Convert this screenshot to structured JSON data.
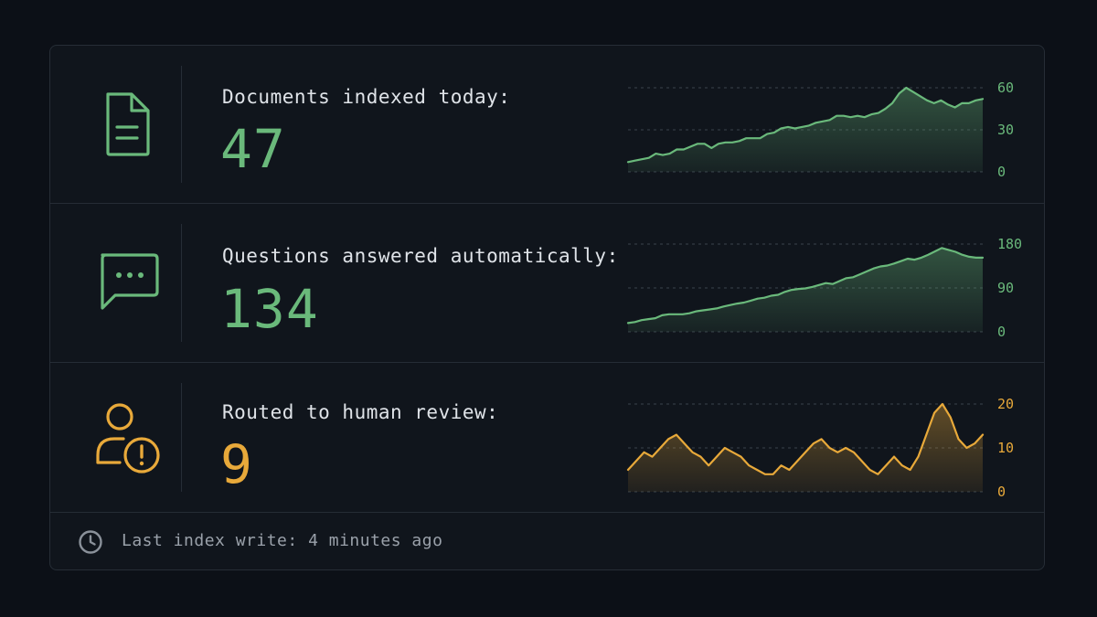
{
  "colors": {
    "green": "#6ab97b",
    "amber": "#e8a93a"
  },
  "metrics": [
    {
      "id": "docs",
      "icon": "document-icon",
      "label": "Documents indexed today:",
      "value": "47",
      "color": "#6ab97b",
      "chart_data": {
        "type": "area",
        "y_ticks": [
          0,
          30,
          60
        ],
        "ylim": [
          0,
          60
        ],
        "values": [
          7,
          8,
          9,
          10,
          13,
          12,
          13,
          16,
          16,
          18,
          20,
          20,
          17,
          20,
          21,
          21,
          22,
          24,
          24,
          24,
          27,
          28,
          31,
          32,
          31,
          32,
          33,
          35,
          36,
          37,
          40,
          40,
          39,
          40,
          39,
          41,
          42,
          45,
          49,
          56,
          60,
          57,
          54,
          51,
          49,
          51,
          48,
          46,
          49,
          49,
          51,
          52
        ]
      }
    },
    {
      "id": "questions",
      "icon": "chat-bubble-icon",
      "label": "Questions answered automatically:",
      "value": "134",
      "color": "#6ab97b",
      "chart_data": {
        "type": "area",
        "y_ticks": [
          0,
          90,
          180
        ],
        "ylim": [
          0,
          180
        ],
        "values": [
          18,
          20,
          24,
          26,
          28,
          34,
          36,
          36,
          36,
          38,
          42,
          44,
          46,
          48,
          52,
          55,
          58,
          60,
          64,
          68,
          70,
          74,
          76,
          82,
          86,
          88,
          89,
          92,
          96,
          100,
          98,
          104,
          110,
          112,
          118,
          124,
          130,
          134,
          136,
          140,
          145,
          150,
          148,
          152,
          158,
          165,
          172,
          168,
          164,
          158,
          154,
          152,
          152
        ]
      }
    },
    {
      "id": "review",
      "icon": "user-alert-icon",
      "label": "Routed to human review:",
      "value": "9",
      "color": "#e8a93a",
      "chart_data": {
        "type": "area",
        "y_ticks": [
          0,
          10,
          20
        ],
        "ylim": [
          0,
          20
        ],
        "values": [
          5,
          7,
          9,
          8,
          10,
          12,
          13,
          11,
          9,
          8,
          6,
          8,
          10,
          9,
          8,
          6,
          5,
          4,
          4,
          6,
          5,
          7,
          9,
          11,
          12,
          10,
          9,
          10,
          9,
          7,
          5,
          4,
          6,
          8,
          6,
          5,
          8,
          13,
          18,
          20,
          17,
          12,
          10,
          11,
          13
        ]
      }
    }
  ],
  "footer": {
    "icon": "clock-icon",
    "text": "Last index write: 4 minutes ago"
  }
}
